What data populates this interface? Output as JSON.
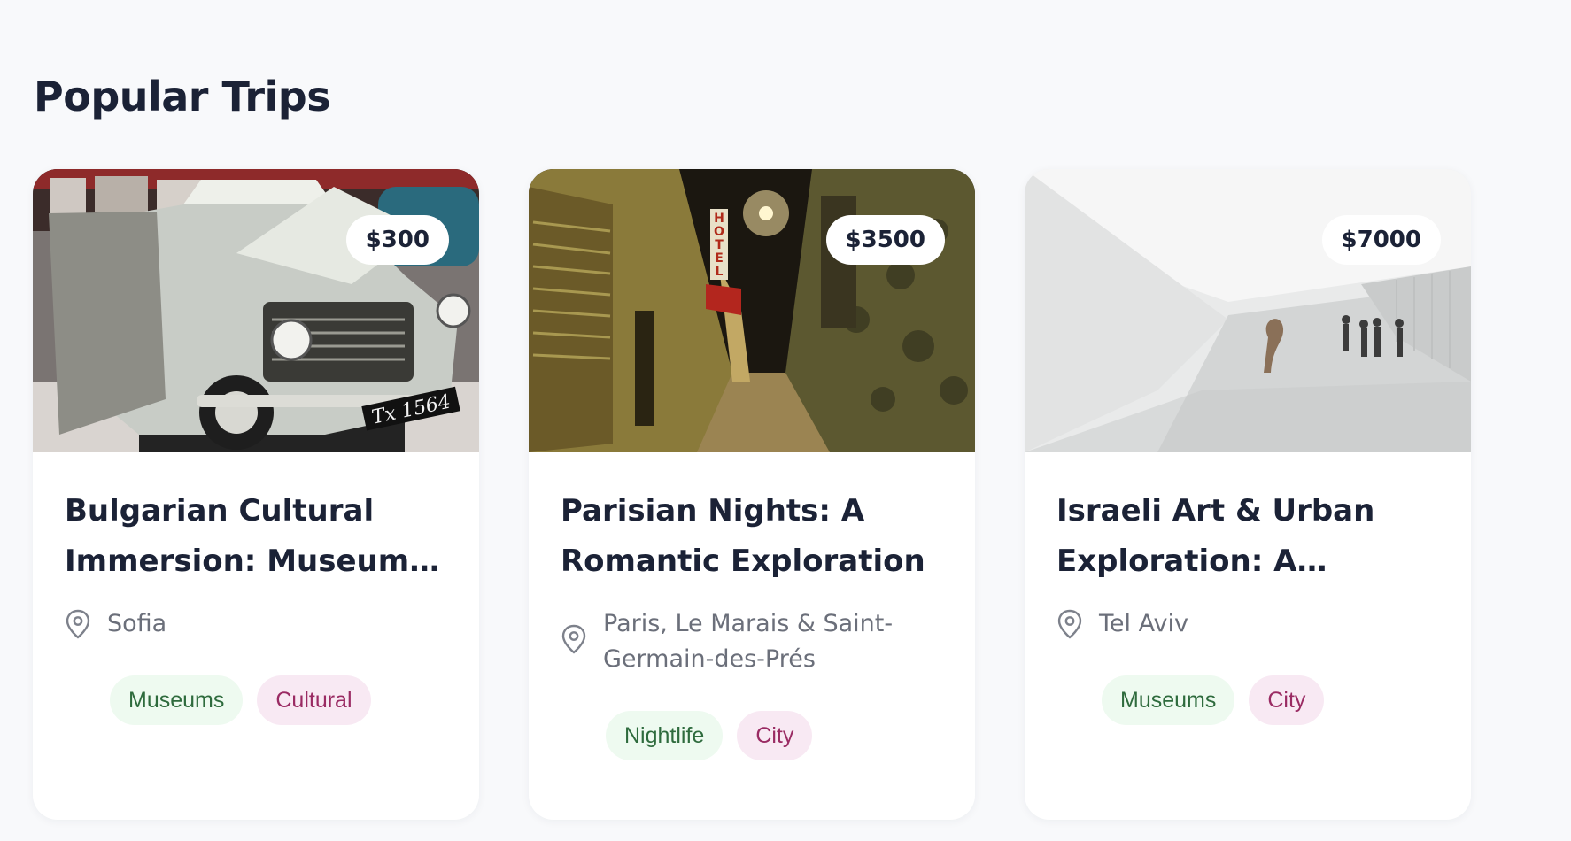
{
  "section": {
    "title": "Popular Trips"
  },
  "trips": [
    {
      "price": "$300",
      "title": "Bulgarian Cultural Immersion: Museums an...",
      "location": "Sofia",
      "tags": [
        {
          "label": "Museums",
          "color": "#2e6b3d",
          "bg": "#eefaf0"
        },
        {
          "label": "Cultural",
          "color": "#9a2b63",
          "bg": "#f8e9f3"
        }
      ]
    },
    {
      "price": "$3500",
      "title": "Parisian Nights: A Romantic Exploration",
      "location": "Paris, Le Marais & Saint-Germain-des-Prés",
      "tags": [
        {
          "label": "Nightlife",
          "color": "#2e6b3d",
          "bg": "#eefaf0"
        },
        {
          "label": "City",
          "color": "#9a2b63",
          "bg": "#f8e9f3"
        }
      ]
    },
    {
      "price": "$7000",
      "title": "Israeli Art & Urban Exploration: A Couple's...",
      "location": "Tel Aviv",
      "tags": [
        {
          "label": "Museums",
          "color": "#2e6b3d",
          "bg": "#eefaf0"
        },
        {
          "label": "City",
          "color": "#9a2b63",
          "bg": "#f8e9f3"
        }
      ]
    }
  ],
  "image_text": {
    "license_plate": "Tx 1564",
    "hotel_sign": "HOTEL",
    "awning_sign": "HOTEL"
  },
  "colors": {
    "background": "#f8f9fb",
    "title": "#1b2236",
    "muted": "#6b6f7a"
  }
}
